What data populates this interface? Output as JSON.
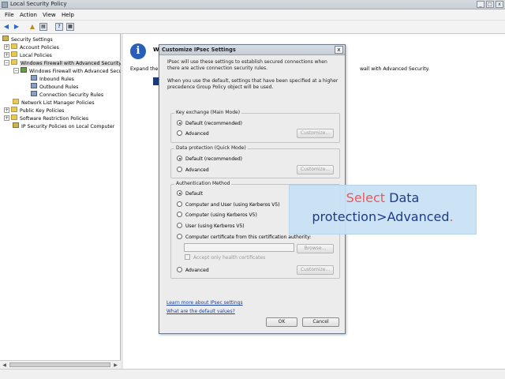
{
  "window": {
    "title": "Local Security Policy"
  },
  "menubar": [
    "File",
    "Action",
    "View",
    "Help"
  ],
  "tree": {
    "items": [
      {
        "label": "Security Settings",
        "icon": "security-settings-icon"
      },
      {
        "label": "Account Policies",
        "icon": "folder-icon"
      },
      {
        "label": "Local Policies",
        "icon": "folder-icon"
      },
      {
        "label": "Windows Firewall with Advanced Security",
        "icon": "folder-icon"
      },
      {
        "label": "Windows Firewall with Advanced Secu",
        "icon": "firewall-icon"
      },
      {
        "label": "Inbound Rules",
        "icon": "rules-icon"
      },
      {
        "label": "Outbound Rules",
        "icon": "rules-icon"
      },
      {
        "label": "Connection Security Rules",
        "icon": "rules-icon"
      },
      {
        "label": "Network List Manager Policies",
        "icon": "folder-icon"
      },
      {
        "label": "Public Key Policies",
        "icon": "folder-icon"
      },
      {
        "label": "Software Restriction Policies",
        "icon": "folder-icon"
      },
      {
        "label": "IP Security Policies on Local Computer",
        "icon": "key-icon"
      }
    ]
  },
  "content": {
    "title_fragment": "W",
    "expand_text": "Expand the",
    "tail_text": "wall with Advanced Security."
  },
  "dialog": {
    "title": "Customize IPsec Settings",
    "intro": "IPsec will use these settings to establish secured connections when there are active connection security rules.",
    "default_note": "When you use the default, settings that have been specified at a higher precedence Group Policy object will be used.",
    "key_exchange": {
      "legend": "Key exchange (Main Mode)",
      "options": [
        "Default (recommended)",
        "Advanced"
      ],
      "selected": 0,
      "customize": "Customize..."
    },
    "data_protection": {
      "legend": "Data protection (Quick Mode)",
      "options": [
        "Default (recommended)",
        "Advanced"
      ],
      "selected": 0,
      "customize": "Customize..."
    },
    "auth": {
      "legend": "Authentication Method",
      "options": [
        "Default",
        "Computer and User (using Kerberos V5)",
        "Computer (using Kerberos V5)",
        "User (using Kerberos V5)",
        "Computer certificate from this certification authority:"
      ],
      "browse": "Browse...",
      "health_cert": "Accept only health certificates",
      "advanced": "Advanced",
      "customize": "Customize...",
      "selected": 0
    },
    "links": {
      "learn_more": "Learn more about IPsec settings",
      "defaults": "What are the default values?"
    },
    "ok": "OK",
    "cancel": "Cancel",
    "close_glyph": "x"
  },
  "callout": {
    "part1": "Select",
    "part2": " Data",
    "line2_text": "protection>Advanced",
    "line2_dot": "."
  },
  "colors": {
    "callout_red": "#e85a5a",
    "callout_blue": "#1f3a8a",
    "link_blue": "#1a3fa0",
    "info_blue": "#2a5fb8"
  }
}
